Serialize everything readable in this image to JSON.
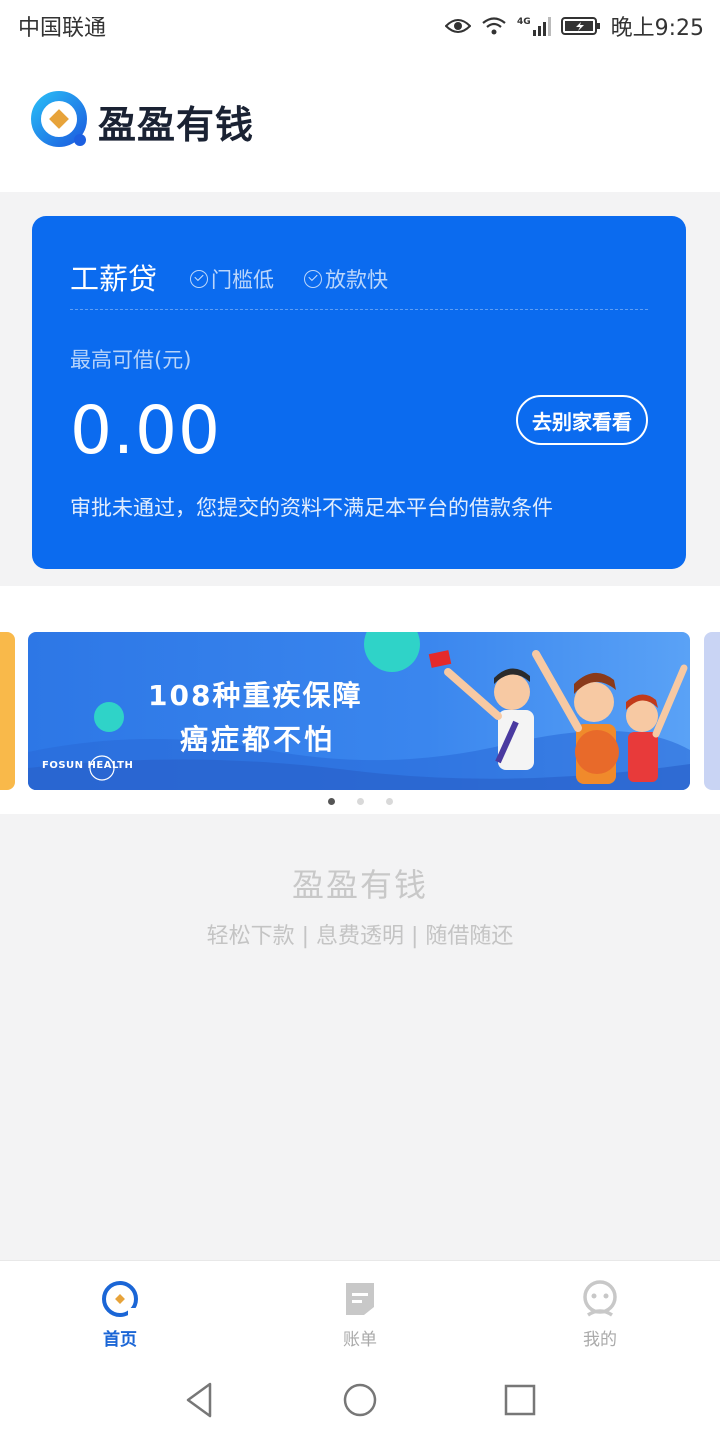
{
  "status_bar": {
    "carrier": "中国联通",
    "network": "4G",
    "time": "晚上9:25"
  },
  "header": {
    "app_name": "盈盈有钱"
  },
  "loan_card": {
    "product": "工薪贷",
    "tags": [
      "门槛低",
      "放款快"
    ],
    "limit_label": "最高可借(元)",
    "amount": "0.00",
    "action_button": "去别家看看",
    "message": "审批未通过，您提交的资料不满足本平台的借款条件",
    "color": "#0b6bef"
  },
  "banner": {
    "line1": "108种重疾保障",
    "line2": "癌症都不怕",
    "brand": "FOSUN HEALTH",
    "slides": 3,
    "active_slide": 1
  },
  "footer": {
    "brand": "盈盈有钱",
    "slogan": "轻松下款 | 息费透明 | 随借随还"
  },
  "tabs": [
    {
      "label": "首页",
      "icon": "home-icon",
      "active": true
    },
    {
      "label": "账单",
      "icon": "bill-icon",
      "active": false
    },
    {
      "label": "我的",
      "icon": "profile-icon",
      "active": false
    }
  ],
  "accent_color": "#1b66d6"
}
